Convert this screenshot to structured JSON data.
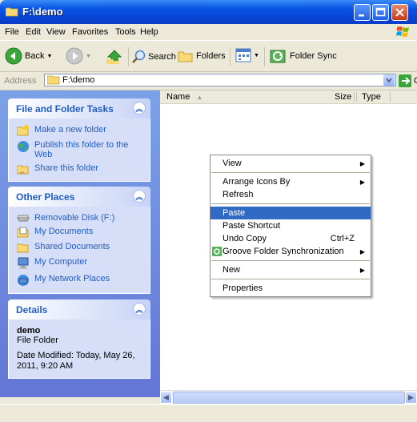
{
  "window": {
    "title": "F:\\demo"
  },
  "menubar": {
    "items": [
      "File",
      "Edit",
      "View",
      "Favorites",
      "Tools",
      "Help"
    ]
  },
  "toolbar": {
    "back_label": "Back",
    "search_label": "Search",
    "folders_label": "Folders",
    "folder_sync_label": "Folder Sync"
  },
  "address": {
    "label": "Address",
    "value": "F:\\demo",
    "go_label": "Go"
  },
  "tasks_panel": {
    "title": "File and Folder Tasks",
    "items": [
      "Make a new folder",
      "Publish this folder to the Web",
      "Share this folder"
    ]
  },
  "places_panel": {
    "title": "Other Places",
    "items": [
      "Removable Disk (F:)",
      "My Documents",
      "Shared Documents",
      "My Computer",
      "My Network Places"
    ]
  },
  "details_panel": {
    "title": "Details",
    "name": "demo",
    "type": "File Folder",
    "modified": "Date Modified: Today, May 26, 2011, 9:20 AM"
  },
  "columns": {
    "name": "Name",
    "size": "Size",
    "type": "Type"
  },
  "context_menu": {
    "view": "View",
    "arrange": "Arrange Icons By",
    "refresh": "Refresh",
    "paste": "Paste",
    "paste_shortcut": "Paste Shortcut",
    "undo_copy": "Undo Copy",
    "undo_shortcut": "Ctrl+Z",
    "groove": "Groove Folder Synchronization",
    "new": "New",
    "properties": "Properties"
  }
}
